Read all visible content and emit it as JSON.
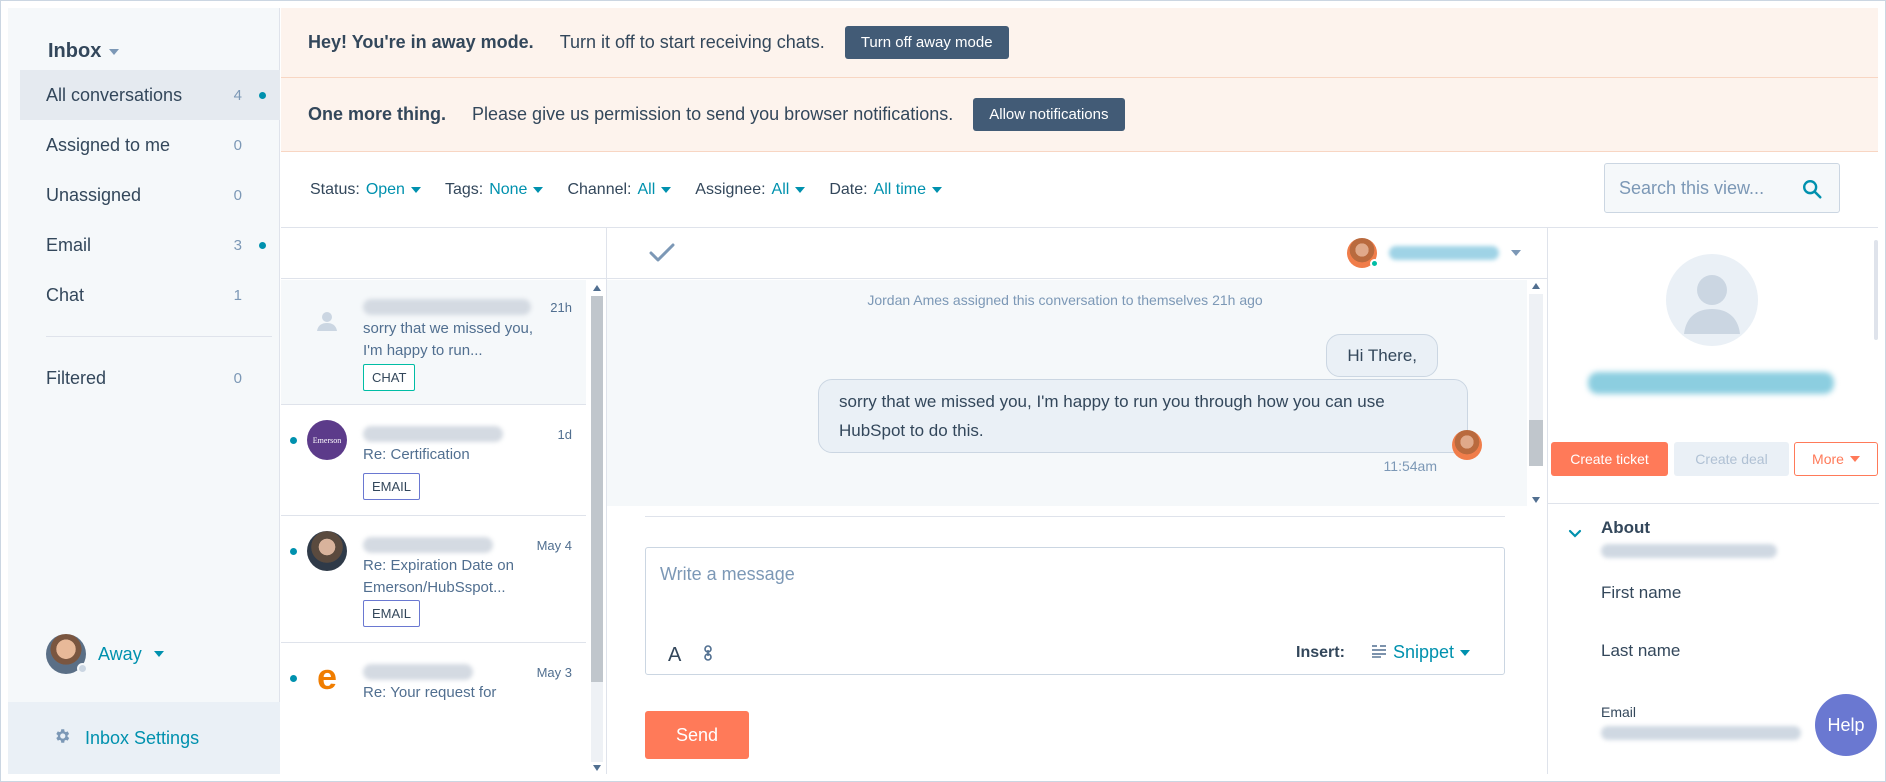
{
  "sidebar": {
    "title": "Inbox",
    "items": [
      {
        "label": "All conversations",
        "count": "4",
        "unread": true
      },
      {
        "label": "Assigned to me",
        "count": "0",
        "unread": false
      },
      {
        "label": "Unassigned",
        "count": "0",
        "unread": false
      },
      {
        "label": "Email",
        "count": "3",
        "unread": true
      },
      {
        "label": "Chat",
        "count": "1",
        "unread": false
      }
    ],
    "filtered": {
      "label": "Filtered",
      "count": "0"
    },
    "status_label": "Away",
    "settings_label": "Inbox Settings"
  },
  "banners": {
    "away": {
      "title": "Hey! You're in away mode.",
      "message": "Turn it off to start receiving chats.",
      "button": "Turn off away mode"
    },
    "notify": {
      "title": "One more thing.",
      "message": "Please give us permission to send you browser notifications.",
      "button": "Allow notifications"
    }
  },
  "filters": [
    {
      "label": "Status:",
      "value": "Open"
    },
    {
      "label": "Tags:",
      "value": "None"
    },
    {
      "label": "Channel:",
      "value": "All"
    },
    {
      "label": "Assignee:",
      "value": "All"
    },
    {
      "label": "Date:",
      "value": "All time"
    }
  ],
  "search": {
    "placeholder": "Search this view..."
  },
  "conversations": [
    {
      "time": "21h",
      "preview": "sorry that we missed you, I'm happy to run...",
      "tag": "CHAT"
    },
    {
      "time": "1d",
      "preview": "Re: Certification",
      "tag": "EMAIL"
    },
    {
      "time": "May 4",
      "preview": "Re: Expiration Date on Emerson/HubSspot...",
      "tag": "EMAIL"
    },
    {
      "time": "May 3",
      "preview": "Re: Your request for",
      "tag": ""
    }
  ],
  "thread": {
    "assign_note": "Jordan Ames assigned this conversation to themselves 21h ago",
    "messages": [
      {
        "text": "Hi There,"
      },
      {
        "text": "sorry that we missed you, I'm happy to run you through how you can use HubSpot to do this."
      }
    ],
    "message_time": "11:54am",
    "composer_placeholder": "Write a message",
    "insert_label": "Insert:",
    "snippet_label": "Snippet",
    "send_label": "Send"
  },
  "contact": {
    "buttons": {
      "ticket": "Create ticket",
      "deal": "Create deal",
      "more": "More"
    },
    "about_label": "About",
    "fields": {
      "first_name": "First name",
      "last_name": "Last name",
      "email": "Email"
    }
  },
  "help_label": "Help",
  "colors": {
    "accent": "#0091ae",
    "primary_button": "#ff7a59",
    "banner_bg": "#fdf3ed",
    "dark_button": "#425b76",
    "help": "#6a78d1"
  }
}
